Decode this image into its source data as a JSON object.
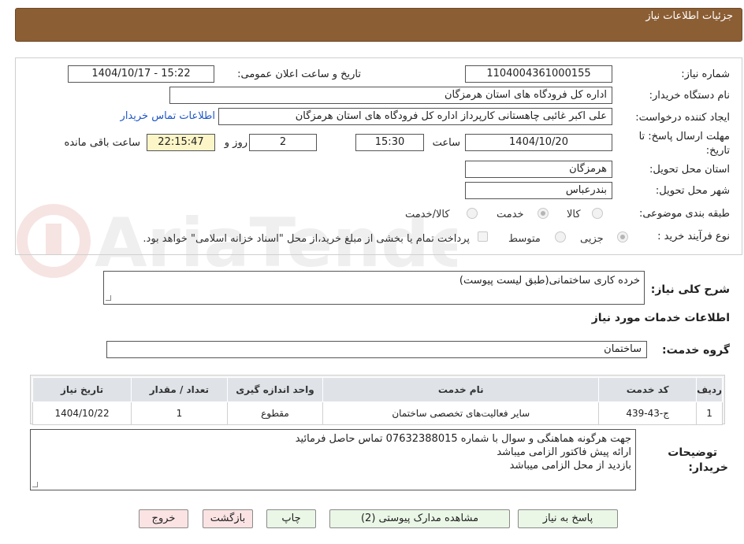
{
  "header": {
    "title": "جزئیات اطلاعات نیاز"
  },
  "form": {
    "need_number_label": "شماره نیاز:",
    "need_number": "1104004361000155",
    "announce_label": "تاریخ و ساعت اعلان عمومی:",
    "announce_value": "1404/10/17 - 15:22",
    "buyer_org_label": "نام دستگاه خریدار:",
    "buyer_org": "اداره کل فرودگاه های استان هرمزگان",
    "requester_label": "ایجاد کننده درخواست:",
    "requester": "علی اکبر غائبی چاهستانی کارپرداز اداره کل فرودگاه های استان هرمزگان",
    "contact_link": "اطلاعات تماس خریدار",
    "deadline_label_1": "مهلت ارسال پاسخ: تا",
    "deadline_label_2": "تاریخ:",
    "deadline_date": "1404/10/20",
    "time_label": "ساعت",
    "deadline_time": "15:30",
    "days_value": "2",
    "days_label": "روز و",
    "remaining_time": "22:15:47",
    "remaining_label": "ساعت باقی مانده",
    "province_label": "استان محل تحویل:",
    "province": "هرمزگان",
    "city_label": "شهر محل تحویل:",
    "city": "بندرعباس",
    "category_label": "طبقه بندی موضوعی:",
    "category_options": [
      "کالا",
      "خدمت",
      "کالا/خدمت"
    ],
    "category_selected": "خدمت",
    "process_label": "نوع فرآیند خرید :",
    "process_options": [
      "جزیی",
      "متوسط"
    ],
    "process_selected": "جزیی",
    "payment_note": "پرداخت تمام یا بخشی از مبلغ خرید،از محل \"اسناد خزانه اسلامی\" خواهد بود."
  },
  "description": {
    "label": "شرح کلی نیاز:",
    "text": "خرده کاری ساختمانی(طبق لیست پیوست)"
  },
  "services": {
    "section_title": "اطلاعات خدمات مورد نیاز",
    "group_label": "گروه خدمت:",
    "group_value": "ساختمان",
    "columns": [
      "ردیف",
      "کد خدمت",
      "نام خدمت",
      "واحد اندازه گیری",
      "تعداد / مقدار",
      "تاریخ نیاز"
    ],
    "rows": [
      [
        "1",
        "ج-43-439",
        "سایر فعالیت‌های تخصصی ساختمان",
        "مقطوع",
        "1",
        "1404/10/22"
      ]
    ]
  },
  "buyer_notes": {
    "label_1": "توضیحات",
    "label_2": "خریدار:",
    "lines": [
      "جهت هرگونه هماهنگی و سوال با شماره 07632388015 تماس حاصل فرمائید",
      "ارائه پیش فاکتور الزامی میباشد",
      "بازدید از محل الزامی میباشد"
    ]
  },
  "buttons": {
    "respond": "پاسخ به نیاز",
    "view_docs": "مشاهده مدارک پیوستی (2)",
    "print": "چاپ",
    "back": "بازگشت",
    "exit": "خروج"
  },
  "colors": {
    "header_bg": "#8b5e34",
    "link": "#1f56c8",
    "button_bg": "#eaf6e6",
    "button_red_bg": "#fbe3e3",
    "remaining_bg": "#fbf5c8"
  }
}
